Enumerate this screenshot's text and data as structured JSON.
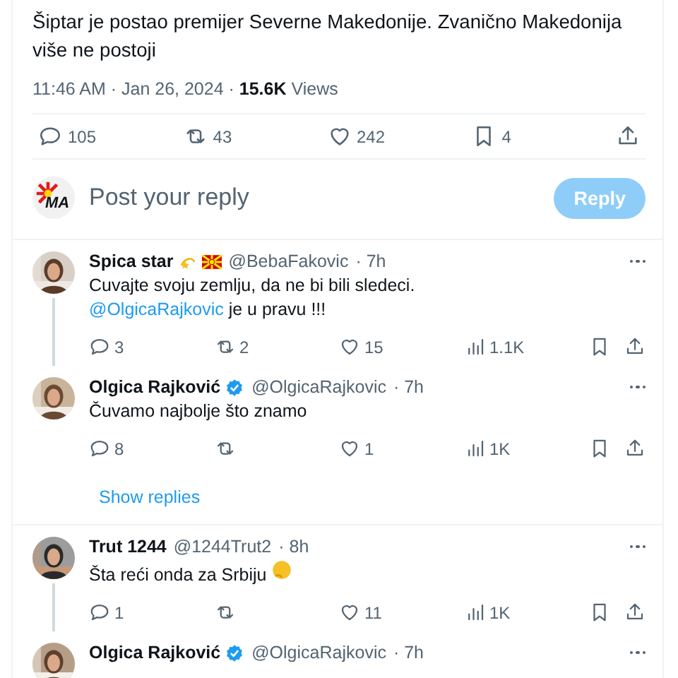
{
  "tweet": {
    "text": "Šiptar je postao premijer Severne Makedonije. Zvanično Makedonija više ne postoji",
    "timestamp": "11:46 AM · Jan 26, 2024 · ",
    "views_count": "15.6K",
    "views_label": "Views",
    "actions": [
      {
        "kind": "reply",
        "count": "105"
      },
      {
        "kind": "retweet",
        "count": "43"
      },
      {
        "kind": "like",
        "count": "242"
      },
      {
        "kind": "bookmark",
        "count": "4"
      },
      {
        "kind": "share"
      }
    ]
  },
  "composer": {
    "logo_text": "MA",
    "placeholder": "Post your reply",
    "button": "Reply",
    "disabled": true
  },
  "replies": [
    {
      "name": "Spica star",
      "flair": true,
      "verified": false,
      "handle": "@BebaFakovic",
      "time": "· 7h",
      "thread_below": true,
      "lines": [
        [
          {
            "kind": "text",
            "text": "Cuvajte svoju zemlju, da ne bi bili sledeci."
          }
        ],
        [
          {
            "kind": "mention",
            "text": "@OlgicaRajkovic"
          },
          {
            "kind": "text",
            "text": " je u pravu !!!"
          }
        ]
      ],
      "thinking_emoji": false,
      "stats": {
        "replies": "3",
        "retweets": "2",
        "likes": "15",
        "views": "1.1K"
      }
    },
    {
      "name": "Olgica Rajković",
      "flair": false,
      "verified": true,
      "handle": "@OlgicaRajkovic",
      "time": "· 7h",
      "thread_below": false,
      "lines": [
        [
          {
            "kind": "text",
            "text": "Čuvamo najbolje što znamo"
          }
        ]
      ],
      "thinking_emoji": false,
      "stats": {
        "replies": "8",
        "likes": "1",
        "views": "1K"
      },
      "show_replies": "Show replies"
    },
    {
      "name": "Trut 1244",
      "flair": false,
      "verified": false,
      "handle": "@1244Trut2",
      "time": "· 8h",
      "thread_below": true,
      "lines": [
        [
          {
            "kind": "text",
            "text": "Šta reći onda za Srbiju"
          }
        ]
      ],
      "thinking_emoji": true,
      "stats": {
        "replies": "1",
        "likes": "11",
        "views": "1K"
      }
    },
    {
      "name": "Olgica Rajković",
      "flair": false,
      "verified": true,
      "handle": "@OlgicaRajkovic",
      "time": "· 7h",
      "thread_below": false
    }
  ]
}
